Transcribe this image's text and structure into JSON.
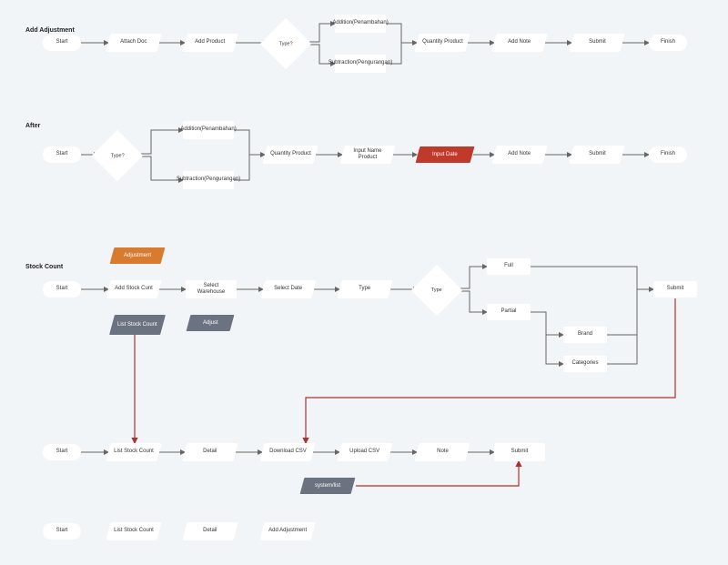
{
  "sections": {
    "add_adjustment": "Add Adjustment",
    "after": "After",
    "stock_count": "Stock Count"
  },
  "flow1": {
    "start": "Start",
    "attach_doc": "Attach Doc",
    "add_product": "Add Product",
    "type": "Type?",
    "addition": "Addition(Penambahan)",
    "subtraction": "Subtraction(Pengurangan)",
    "quantity": "Quantity Product",
    "add_note": "Add Note",
    "submit": "Submit",
    "finish": "Finish"
  },
  "flow2": {
    "start": "Start",
    "type": "Type?",
    "addition": "Addition(Penambahan)",
    "subtraction": "Subtraction(Pengurangan)",
    "quantity": "Quantity Product",
    "input_name": "Input Name Product",
    "input_date": "Input Date",
    "add_note": "Add Note",
    "submit": "Submit",
    "finish": "Finish"
  },
  "tags": {
    "adjustment": "Adjustment",
    "list_stock_count": "List Stock Count",
    "adjust": "Adjust",
    "system_list": "system/list"
  },
  "flow3": {
    "start": "Start",
    "add_stock": "Add Stock Cunt",
    "select_warehouse": "Select Warehouse",
    "select_date": "Select Date",
    "type": "Type",
    "full": "Full",
    "partial": "Partial",
    "brand": "Brand",
    "categories": "Categories",
    "submit": "Submit"
  },
  "flow4": {
    "start": "Start",
    "list_stock": "List Stock Count",
    "detail": "Detail",
    "download_csv": "Download CSV",
    "upload_csv": "Upload CSV",
    "note": "Note",
    "submit": "Submit"
  },
  "flow5": {
    "start": "Start",
    "list_stock": "List Stock Count",
    "detail": "Detail",
    "add_adjustment": "Add Adjustment"
  }
}
